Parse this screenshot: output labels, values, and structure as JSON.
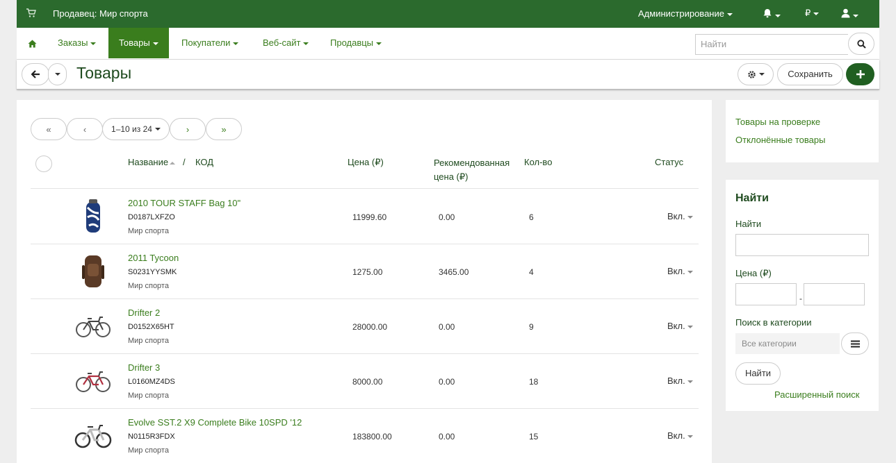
{
  "topbar": {
    "vendor_label": "Продавец: Мир спорта",
    "admin_label": "Администрирование",
    "currency_label": "₽"
  },
  "nav": {
    "items": [
      {
        "label": "Заказы"
      },
      {
        "label": "Товары"
      },
      {
        "label": "Покупатели"
      },
      {
        "label": "Веб-сайт"
      },
      {
        "label": "Продавцы"
      }
    ],
    "active": "Товары",
    "search_placeholder": "Найти"
  },
  "page": {
    "title": "Товары",
    "save_label": "Сохранить"
  },
  "pager": {
    "first": "«",
    "prev": "‹",
    "range": "1–10 из 24",
    "next": "›",
    "last": "»"
  },
  "table": {
    "headers": {
      "name": "Название",
      "sep": "/",
      "code": "КОД",
      "price": "Цена (₽)",
      "rec_line1": "Рекомендованная",
      "rec_line2": "цена (₽)",
      "qty": "Кол-во",
      "status": "Статус"
    },
    "rows": [
      {
        "name": "2010 TOUR STAFF Bag 10\"",
        "code": "D0187LXFZO",
        "vendor": "Мир спорта",
        "price": "11999.60",
        "rec": "0.00",
        "qty": "6",
        "status": "Вкл.",
        "thumb": "golf-bag"
      },
      {
        "name": "2011 Tycoon",
        "code": "S0231YYSMK",
        "vendor": "Мир спорта",
        "price": "1275.00",
        "rec": "3465.00",
        "qty": "4",
        "status": "Вкл.",
        "thumb": "backpack"
      },
      {
        "name": "Drifter 2",
        "code": "D0152X65HT",
        "vendor": "Мир спорта",
        "price": "28000.00",
        "rec": "0.00",
        "qty": "9",
        "status": "Вкл.",
        "thumb": "bicycle"
      },
      {
        "name": "Drifter 3",
        "code": "L0160MZ4DS",
        "vendor": "Мир спорта",
        "price": "8000.00",
        "rec": "0.00",
        "qty": "18",
        "status": "Вкл.",
        "thumb": "bicycle-red"
      },
      {
        "name": "Evolve SST.2 X9 Complete Bike 10SPD '12",
        "code": "N0115R3FDX",
        "vendor": "Мир спорта",
        "price": "183800.00",
        "rec": "0.00",
        "qty": "15",
        "status": "Вкл.",
        "thumb": "bicycle-white"
      }
    ]
  },
  "sidebar": {
    "links": [
      "Товары на проверке",
      "Отклонённые товары"
    ],
    "search": {
      "heading": "Найти",
      "find_label": "Найти",
      "price_label": "Цена (₽)",
      "dash": "-",
      "category_label": "Поиск в категории",
      "category_placeholder": "Все категории",
      "find_button": "Найти",
      "advanced_link": "Расширенный поиск"
    }
  },
  "colors": {
    "topbar": "#2b6a2d",
    "accent": "#3a7d1d",
    "dark_green": "#205f21"
  }
}
